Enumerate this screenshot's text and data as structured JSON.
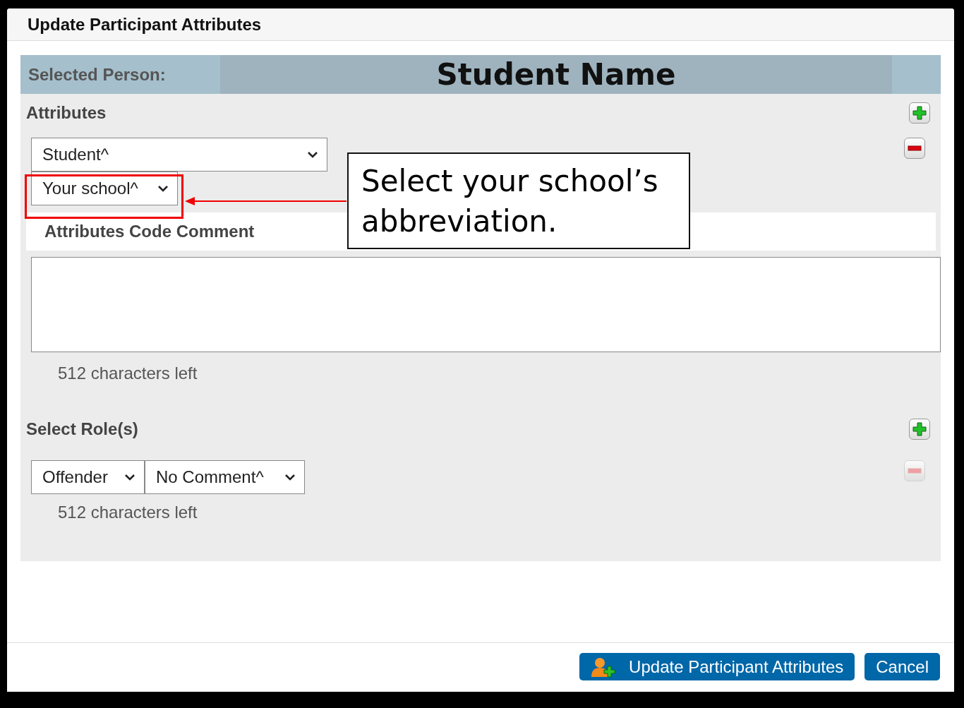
{
  "dialog": {
    "title": "Update Participant Attributes"
  },
  "selected_person": {
    "label": "Selected Person:",
    "name": "Student Name"
  },
  "attributes": {
    "heading": "Attributes",
    "add_button": {
      "disabled": false
    },
    "remove_button": {
      "disabled": false
    },
    "selects": [
      {
        "value": "Student^",
        "highlighted": false
      },
      {
        "value": "Your school^",
        "highlighted": true
      }
    ],
    "comment_label": "Attributes Code Comment",
    "chars_left": "512 characters left"
  },
  "roles": {
    "heading": "Select Role(s)",
    "add_button": {
      "disabled": false
    },
    "remove_button": {
      "disabled": true
    },
    "selects": [
      {
        "value": "Offender"
      },
      {
        "value": "No Comment^"
      }
    ],
    "chars_left": "512 characters left"
  },
  "callout": {
    "text": "Select your school’s abbreviation."
  },
  "buttons": [
    {
      "label": "Update Participant Attributes",
      "kind": "icon"
    },
    {
      "label": "Cancel",
      "kind": "plain"
    }
  ]
}
